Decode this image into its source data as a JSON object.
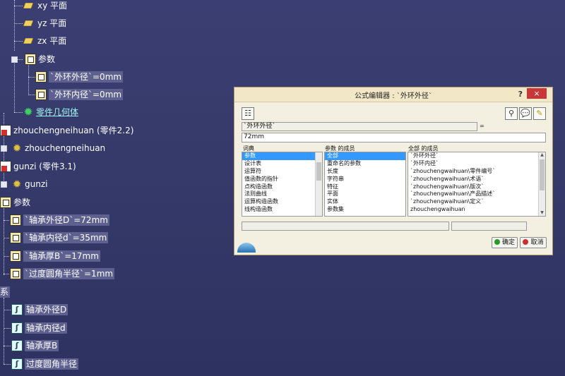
{
  "tree": {
    "planes": [
      "xy 平面",
      "yz 平面",
      "zx 平面"
    ],
    "params_group": "参数",
    "inner_params": [
      "`外环外径`=0mm",
      "`外环内径`=0mm"
    ],
    "part_body": "零件几何体",
    "parts": [
      {
        "instance": "zhouchengneihuan (零件2.2)",
        "name": "zhouchengneihuan"
      },
      {
        "instance": "gunzi (零件3.1)",
        "name": "gunzi"
      }
    ],
    "root_params_group": "参数",
    "root_params": [
      "`轴承外径D`=72mm",
      "`轴承内径d`=35mm",
      "`轴承厚B`=17mm",
      "`过度圆角半径`=1mm"
    ],
    "laws_group": "关系",
    "laws": [
      "轴承外径D",
      "轴承内径d",
      "轴承厚B",
      "过度圆角半径"
    ]
  },
  "dialog": {
    "title": "公式编辑器 : `外环外径`",
    "help": "?",
    "close": "×",
    "param_name": "`外环外径`",
    "equals": "=",
    "formula": "72mm",
    "col1_header": "词典",
    "col1_items": [
      "参数",
      "设计表",
      "运算符",
      "值函数的指针",
      "点构造函数",
      "法则曲线",
      "运算构造函数",
      "线构造函数"
    ],
    "col2_header": "参数 的成员",
    "col2_items": [
      "全部",
      "重命名的参数",
      "长度",
      "字符串",
      "特征",
      "平面",
      "实体",
      "参数集"
    ],
    "col3_header": "全部 的成员",
    "col3_items": [
      "`外环外径`",
      "`外环内径`",
      "`zhouchengwaihuan\\零件编号`",
      "`zhouchengwaihuan\\术语`",
      "`zhouchengwaihuan\\版次`",
      "`zhouchengwaihuan\\产品描述`",
      "`zhouchengwaihuan\\定义`",
      "zhouchengwaihuan"
    ],
    "ok_label": "确定",
    "cancel_label": "取消"
  },
  "colors": {
    "background": "#363a6a",
    "dialog_title": "#f2e8c8",
    "selection": "#3399ff",
    "close": "#c8383a"
  }
}
